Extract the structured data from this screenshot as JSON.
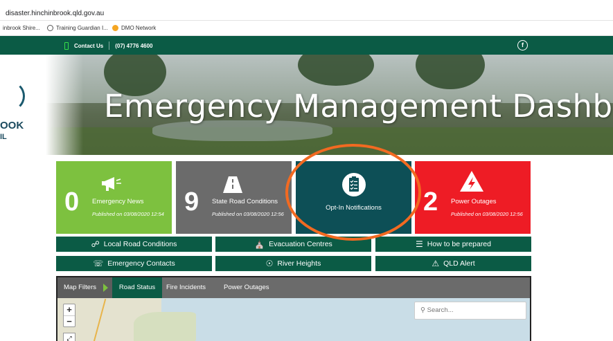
{
  "browser": {
    "url": "disaster.hinchinbrook.qld.gov.au",
    "bookmarks": [
      {
        "label": "inbrook Shire...",
        "icon": "site-favicon"
      },
      {
        "label": "Training Guardian I...",
        "icon": "globe-icon"
      },
      {
        "label": "DMO Network",
        "icon": "dmo-favicon"
      }
    ]
  },
  "topbar": {
    "contact_label": "Contact Us",
    "phone": "(07) 4776 4600",
    "social_icon": "facebook-icon"
  },
  "hero": {
    "logo_line1": "OOK",
    "logo_line2": "IL",
    "title": "Emergency Management Dashboard"
  },
  "tiles": {
    "news": {
      "count": "0",
      "label": "Emergency News",
      "published": "Published on 03/08/2020 12:54",
      "icon": "megaphone-icon",
      "color": "#7dc13f"
    },
    "road": {
      "count": "9",
      "label": "State Road Conditions",
      "published": "Published on 03/08/2020 12:56",
      "icon": "road-icon",
      "color": "#6b6b6b"
    },
    "opt_in": {
      "label": "Opt-In Notifications",
      "icon": "clipboard-checklist-icon",
      "color": "#0d4f56"
    },
    "power": {
      "count": "2",
      "label": "Power Outages",
      "published": "Published on 03/08/2020 12:56",
      "icon": "warning-bolt-icon",
      "color": "#ee1c25"
    }
  },
  "quick_links": [
    {
      "label": "Local Road Conditions",
      "icon": "share-icon"
    },
    {
      "label": "Evacuation Centres",
      "icon": "building-people-icon"
    },
    {
      "label": "How to be prepared",
      "icon": "list-icon"
    },
    {
      "label": "Emergency Contacts",
      "icon": "phonebook-icon"
    },
    {
      "label": "River Heights",
      "icon": "gauge-icon"
    },
    {
      "label": "QLD Alert",
      "icon": "warning-icon"
    }
  ],
  "map": {
    "filters_label": "Map Filters",
    "tabs": [
      "Road Status",
      "Fire Incidents",
      "Power Outages"
    ],
    "active_tab": "Road Status",
    "zoom_in": "+",
    "zoom_out": "−",
    "search_placeholder": "Search..."
  },
  "annotation": {
    "highlight_color": "#f26a21"
  }
}
